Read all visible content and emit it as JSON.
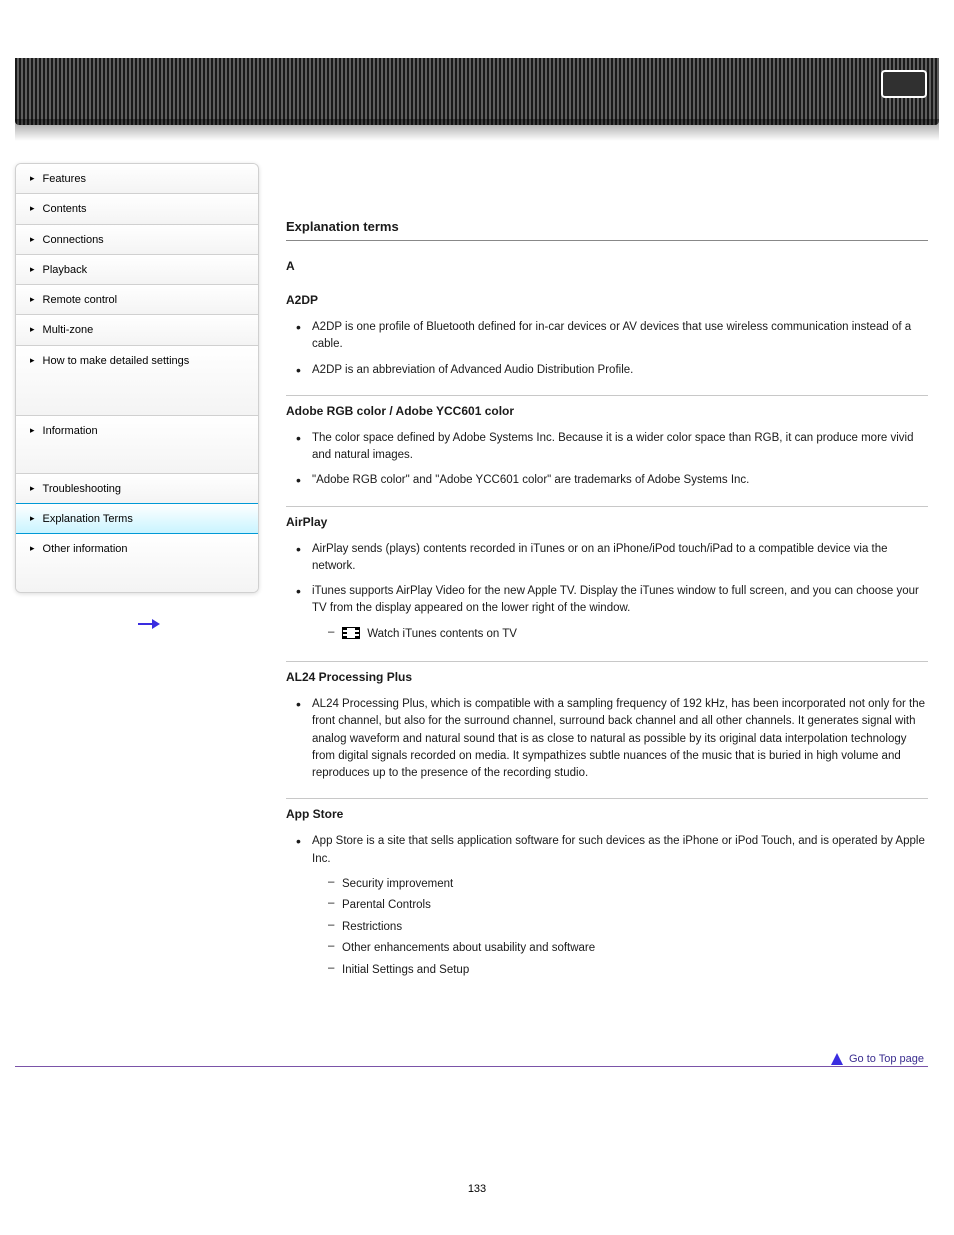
{
  "sidebar": {
    "items": [
      {
        "label": "Features"
      },
      {
        "label": "Contents"
      },
      {
        "label": "Connections"
      },
      {
        "label": "Playback"
      },
      {
        "label": "Remote control"
      },
      {
        "label": "Multi-zone"
      },
      {
        "label": "How to make detailed settings"
      },
      {
        "label": "Information"
      },
      {
        "label": "Troubleshooting"
      },
      {
        "label": "Explanation Terms"
      },
      {
        "label": "Other information"
      }
    ],
    "activeIndex": 9
  },
  "nextLabel": "",
  "title": "Explanation terms",
  "groups": [
    {
      "heading": "A",
      "items": [
        {
          "term": "A2DP",
          "notes": [
            "A2DP is one profile of Bluetooth defined for in-car devices or AV devices that use wireless communication instead of a cable.",
            "A2DP is an abbreviation of Advanced Audio Distribution Profile."
          ]
        },
        {
          "term": "Adobe RGB color / Adobe YCC601 color",
          "notes": [
            "The color space defined by Adobe Systems Inc. Because it is a wider color space than RGB, it can produce more vivid and natural images.",
            "\"Adobe RGB color\" and \"Adobe YCC601 color\" are trademarks of Adobe Systems Inc."
          ]
        },
        {
          "term": "AirPlay",
          "notes": [
            "AirPlay sends (plays) contents recorded in iTunes or on an iPhone/iPod touch/iPad to a compatible device via the network.",
            "iTunes supports AirPlay Video for the new Apple TV. Display the iTunes window to full screen, and you can choose your TV from the display appeared on the lower right of the window.",
            "  Watch iTunes contents on TV",
            ""
          ],
          "hasFilmIcon": true
        },
        {
          "term": "AL24 Processing Plus",
          "notes": [
            "AL24 Processing Plus, which is compatible with a sampling frequency of 192 kHz, has been incorporated not only for the front channel, but also for the surround channel, surround back channel and all other channels. It generates signal with analog waveform and natural sound that is as close to natural as possible by its original data interpolation technology from digital signals recorded on media. It sympathizes subtle nuances of the music that is buried in high volume and reproduces up to the presence of the recording studio."
          ]
        },
        {
          "term": "App Store",
          "notes": [
            "App Store is a site that sells application software for such devices as the iPhone or iPod Touch, and is operated by Apple Inc.",
            "Security improvement",
            "Parental Controls",
            "Restrictions",
            "Other enhancements about usability and software",
            "Initial Settings and Setup"
          ],
          "asDash": true
        }
      ]
    }
  ],
  "topLinkLabel": "Go to Top page",
  "pageNumber": "133"
}
